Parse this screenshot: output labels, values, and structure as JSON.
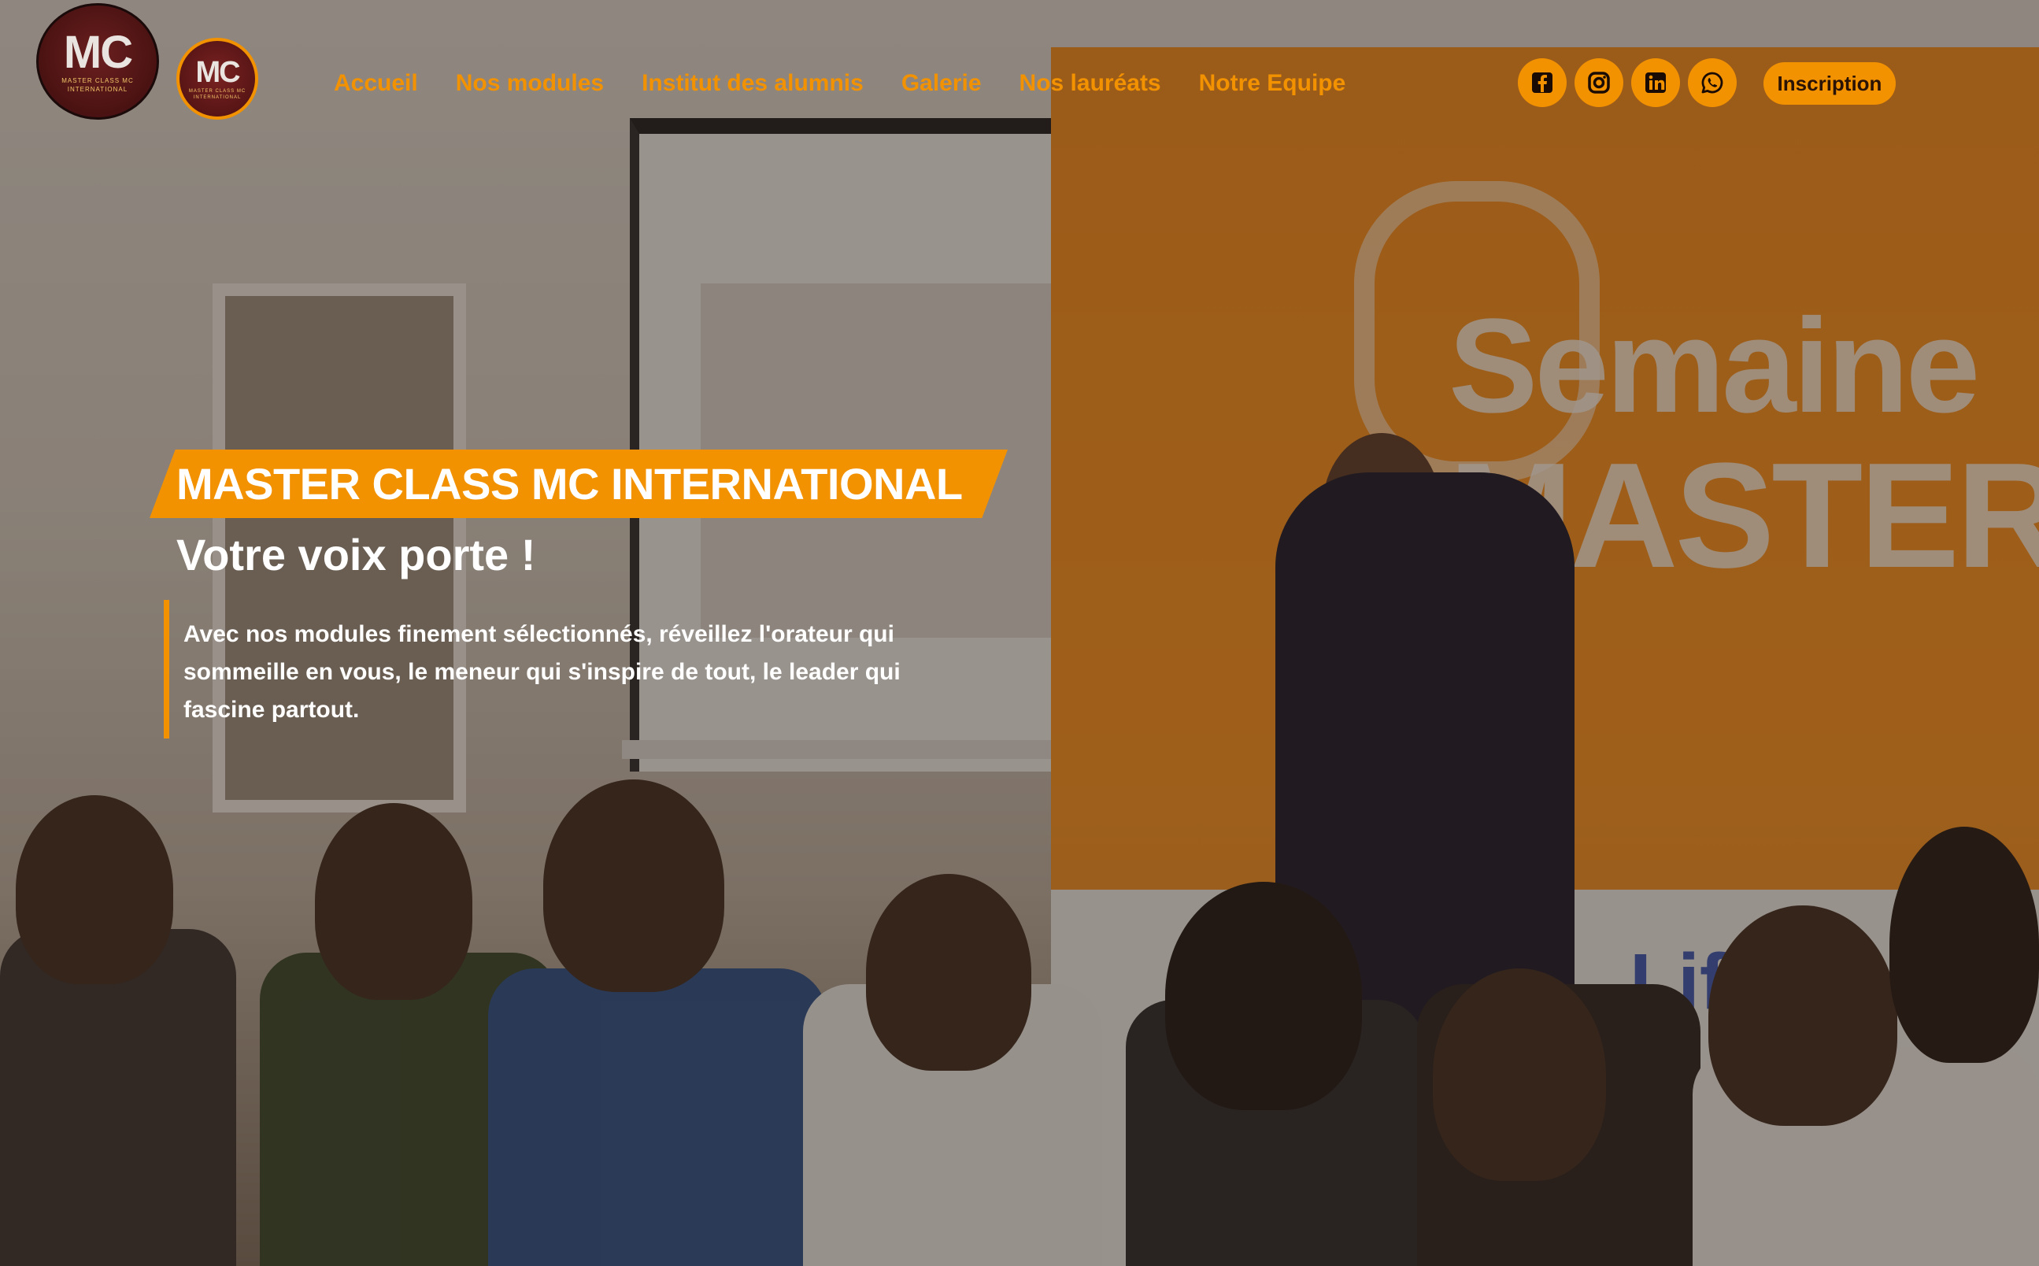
{
  "brand": {
    "logo_text": "MC",
    "logo_subtext": "MASTER CLASS MC",
    "logo_tagline": "INTERNATIONAL"
  },
  "nav": {
    "items": [
      {
        "label": "Accueil"
      },
      {
        "label": "Nos modules"
      },
      {
        "label": "Institut des alumnis"
      },
      {
        "label": "Galerie"
      },
      {
        "label": "Nos lauréats"
      },
      {
        "label": "Notre Equipe"
      }
    ]
  },
  "socials": [
    {
      "icon": "facebook-icon"
    },
    {
      "icon": "instagram-icon"
    },
    {
      "icon": "linkedin-icon"
    },
    {
      "icon": "whatsapp-icon"
    }
  ],
  "signup_label": "Inscription",
  "hero": {
    "title": "MASTER CLASS MC INTERNATIONAL",
    "subtitle": "Votre voix porte !",
    "description": "Avec nos modules finement sélectionnés, réveillez l'orateur qui sommeille en vous, le meneur qui s'inspire de tout, le leader qui fascine partout."
  },
  "background": {
    "banner_line1": "Semaine",
    "banner_line2": "MASTER CL",
    "sponsor_text": "Lif"
  },
  "colors": {
    "accent": "#f39200",
    "text": "#ffffff",
    "logo_bg": "#561414"
  }
}
